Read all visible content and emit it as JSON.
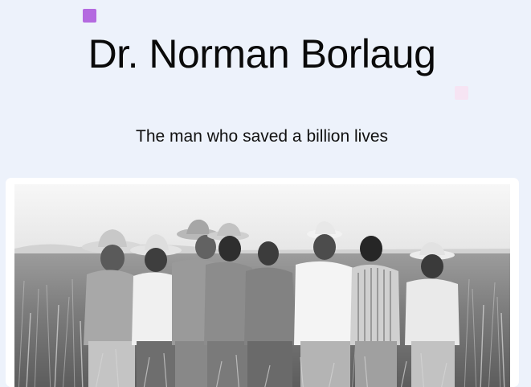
{
  "header": {
    "title": "Dr. Norman Borlaug",
    "subtitle": "The man who saved a billion lives"
  },
  "photo": {
    "description_icon": "photo-of-men-in-wheat-field"
  },
  "colors": {
    "background": "#edf2fb",
    "accent_purple": "#b46ae0",
    "accent_pink": "#f6e4f3",
    "card": "#ffffff"
  }
}
